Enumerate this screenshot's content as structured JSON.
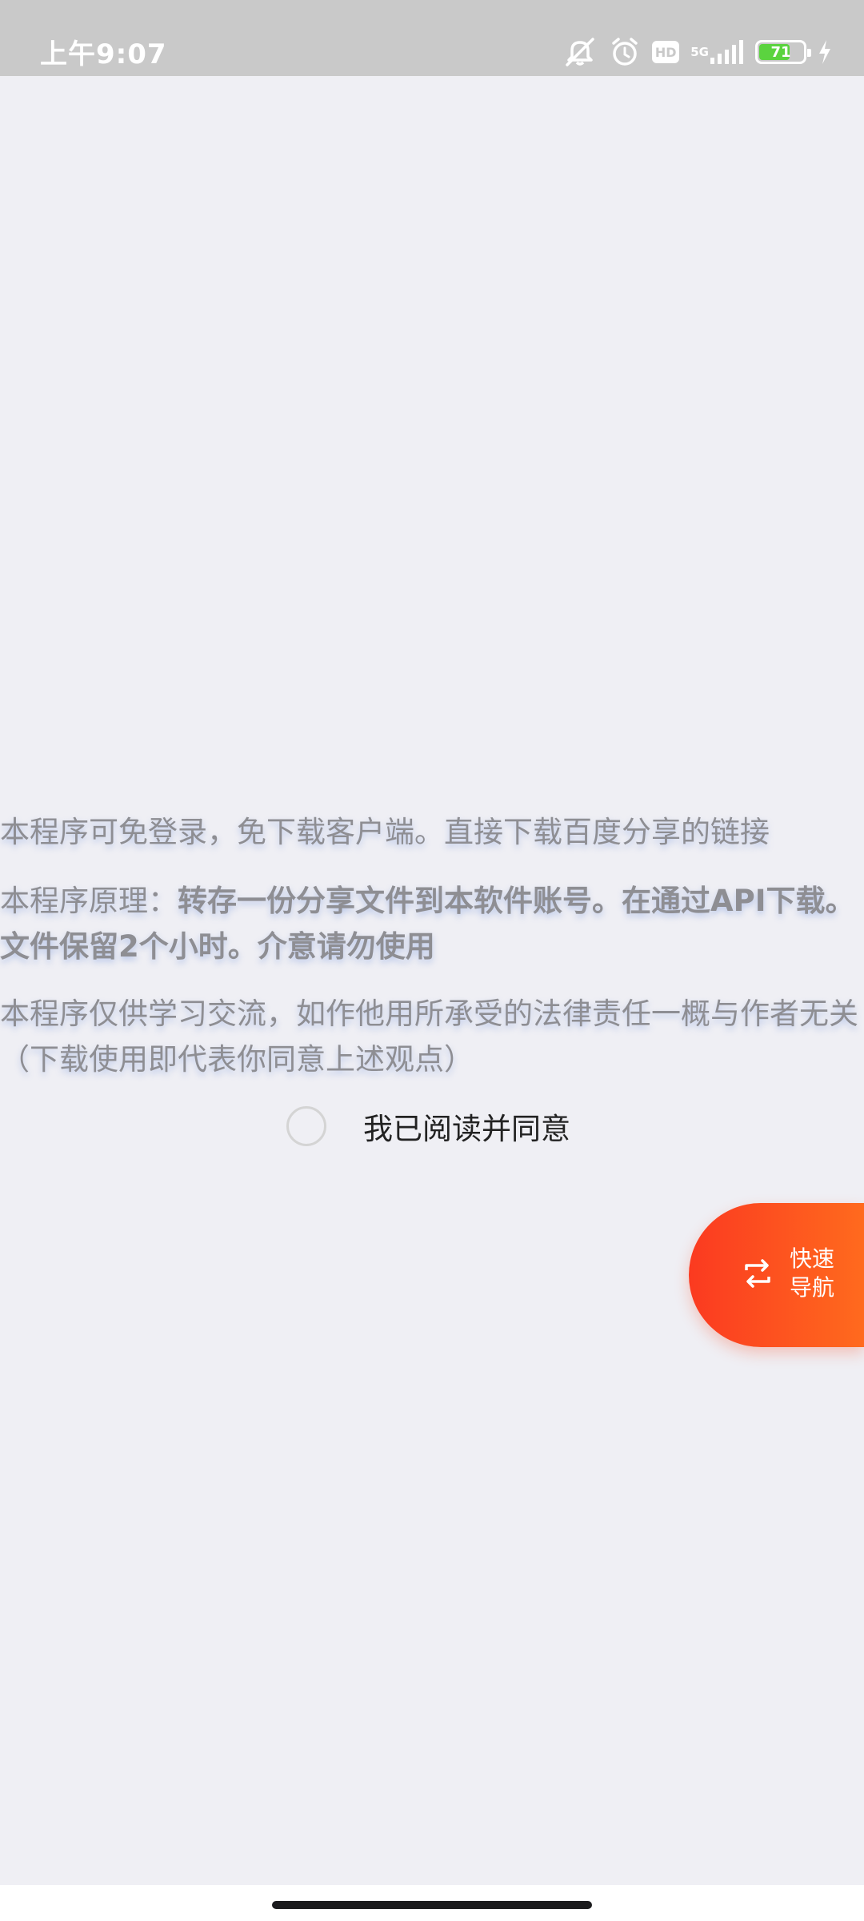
{
  "status_bar": {
    "time": "上午9:07",
    "icons": [
      "mute-icon",
      "alarm-icon",
      "hd-icon",
      "5g-signal-icon",
      "battery-icon",
      "charging-icon"
    ],
    "hd_label": "HD",
    "network_label": "5G",
    "battery_level": "71",
    "battery_percent": 71
  },
  "notices": {
    "line1": "本程序可免登录，免下载客户端。直接下载百度分享的链接",
    "principle_label": "本程序原理：",
    "principle_bold": "转存一份分享文件到本软件账号。在通过API下载。文件保留2个小时。介意请勿使用",
    "disclaimer": "本程序仅供学习交流，如作他用所承受的法律责任一概与作者无关（下载使用即代表你同意上述观点）"
  },
  "agreement": {
    "label": "我已阅读并同意",
    "checked": false
  },
  "quick_nav": {
    "label_line1": "快速",
    "label_line2": "导航",
    "icon": "swap-arrows-icon"
  },
  "colors": {
    "background": "#efeff4",
    "status_bar": "#c9c9c9",
    "accent_start": "#fb3a20",
    "accent_end": "#ff6a1e",
    "muted_text": "#8e8e93",
    "battery_fill": "#5bd33f"
  }
}
